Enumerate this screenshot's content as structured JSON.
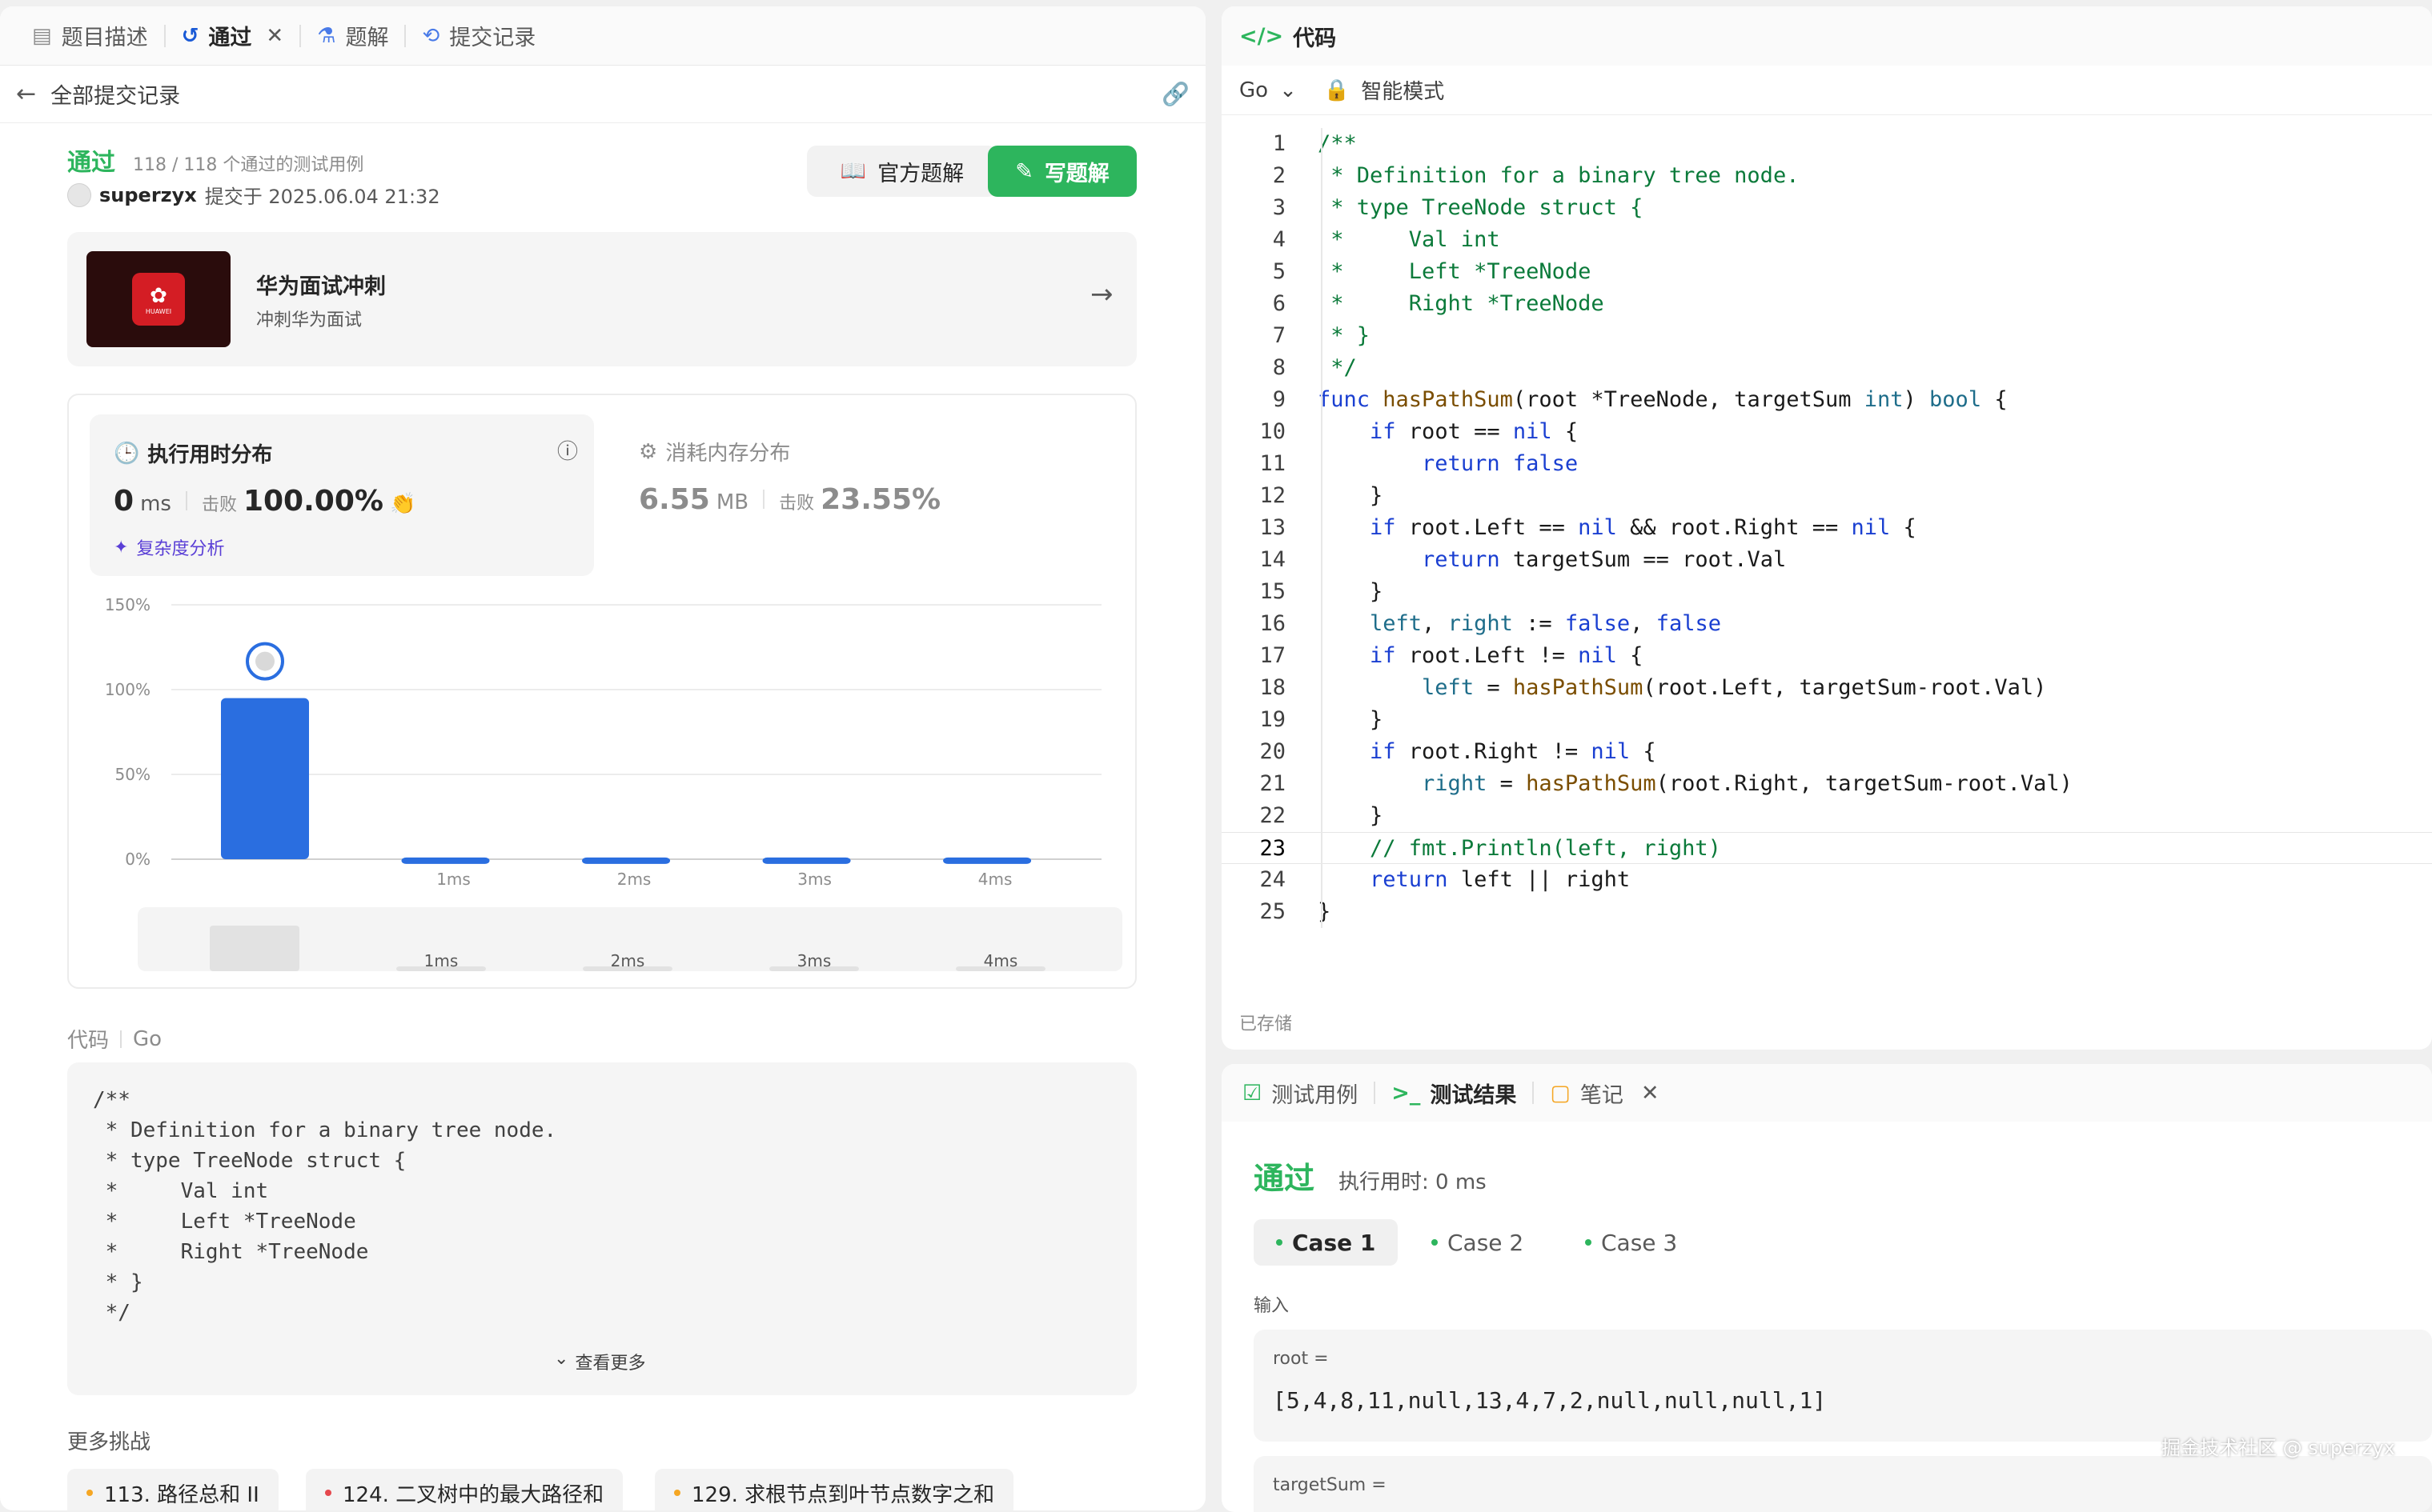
{
  "left_tabs": [
    {
      "label": "题目描述",
      "icon": "doc-icon"
    },
    {
      "label": "通过",
      "icon": "history-icon"
    },
    {
      "label": "题解",
      "icon": "flask-icon"
    },
    {
      "label": "提交记录",
      "icon": "clock-history-icon"
    }
  ],
  "back_label": "全部提交记录",
  "result": {
    "status": "通过",
    "cases": "118 / 118 个通过的测试用例",
    "user": "superzyx",
    "submitted": "提交于 2025.06.04 21:32"
  },
  "buttons": {
    "official": "官方题解",
    "write": "写题解"
  },
  "promo": {
    "title": "华为面试冲刺",
    "subtitle": "冲刺华为面试",
    "logo_text": "HUAWEI"
  },
  "runtime": {
    "title": "执行用时分布",
    "value": "0",
    "unit": "ms",
    "beat_label": "击败",
    "beat": "100.00%",
    "analysis": "复杂度分析"
  },
  "memory": {
    "title": "消耗内存分布",
    "value": "6.55",
    "unit": "MB",
    "beat_label": "击败",
    "beat": "23.55%"
  },
  "chart_data": {
    "type": "bar",
    "categories": [
      "",
      "1ms",
      "2ms",
      "3ms",
      "4ms"
    ],
    "values": [
      95,
      1,
      1,
      1,
      1
    ],
    "yticks": [
      "150%",
      "100%",
      "50%",
      "0%"
    ],
    "ylim": [
      0,
      150
    ],
    "highlight_index": 0,
    "bar_color": "#2a6ee0"
  },
  "code_section": {
    "label": "代码",
    "lang": "Go",
    "more": "查看更多"
  },
  "snippet": [
    "/**",
    " * Definition for a binary tree node.",
    " * type TreeNode struct {",
    " *     Val int",
    " *     Left *TreeNode",
    " *     Right *TreeNode",
    " * }",
    " */"
  ],
  "more_challenges": {
    "title": "更多挑战",
    "items": [
      "113. 路径总和 II",
      "124. 二叉树中的最大路径和",
      "129. 求根节点到叶节点数字之和"
    ]
  },
  "editor": {
    "title": "代码",
    "lang": "Go",
    "mode": "智能模式",
    "saved": "已存储",
    "active_line": 23
  },
  "code": [
    [
      [
        "cm",
        "/**"
      ]
    ],
    [
      [
        "cm",
        " * Definition for a binary tree node."
      ]
    ],
    [
      [
        "cm",
        " * type TreeNode struct {"
      ]
    ],
    [
      [
        "cm",
        " *     Val int"
      ]
    ],
    [
      [
        "cm",
        " *     Left *TreeNode"
      ]
    ],
    [
      [
        "cm",
        " *     Right *TreeNode"
      ]
    ],
    [
      [
        "cm",
        " * }"
      ]
    ],
    [
      [
        "cm",
        " */"
      ]
    ],
    [
      [
        "kw",
        "func "
      ],
      [
        "fn",
        "hasPathSum"
      ],
      [
        "ct",
        "(root *TreeNode, targetSum "
      ],
      [
        "ty",
        "int"
      ],
      [
        "ct",
        ") "
      ],
      [
        "ty",
        "bool"
      ],
      [
        "ct",
        " {"
      ]
    ],
    [
      [
        "ct",
        "    "
      ],
      [
        "kw",
        "if"
      ],
      [
        "ct",
        " root == "
      ],
      [
        "kw",
        "nil"
      ],
      [
        "ct",
        " {"
      ]
    ],
    [
      [
        "ct",
        "        "
      ],
      [
        "kw",
        "return false"
      ]
    ],
    [
      [
        "ct",
        "    }"
      ]
    ],
    [
      [
        "ct",
        "    "
      ],
      [
        "kw",
        "if"
      ],
      [
        "ct",
        " root.Left == "
      ],
      [
        "kw",
        "nil"
      ],
      [
        "ct",
        " && root.Right == "
      ],
      [
        "kw",
        "nil"
      ],
      [
        "ct",
        " {"
      ]
    ],
    [
      [
        "ct",
        "        "
      ],
      [
        "kw",
        "return"
      ],
      [
        "ct",
        " targetSum == root.Val"
      ]
    ],
    [
      [
        "ct",
        "    }"
      ]
    ],
    [
      [
        "ct",
        "    "
      ],
      [
        "ty",
        "left"
      ],
      [
        "ct",
        ", "
      ],
      [
        "ty",
        "right"
      ],
      [
        "ct",
        " := "
      ],
      [
        "kw",
        "false"
      ],
      [
        "ct",
        ", "
      ],
      [
        "kw",
        "false"
      ]
    ],
    [
      [
        "ct",
        "    "
      ],
      [
        "kw",
        "if"
      ],
      [
        "ct",
        " root.Left != "
      ],
      [
        "kw",
        "nil"
      ],
      [
        "ct",
        " {"
      ]
    ],
    [
      [
        "ct",
        "        "
      ],
      [
        "ty",
        "left"
      ],
      [
        "ct",
        " = "
      ],
      [
        "fn",
        "hasPathSum"
      ],
      [
        "ct",
        "(root.Left, targetSum-root.Val)"
      ]
    ],
    [
      [
        "ct",
        "    }"
      ]
    ],
    [
      [
        "ct",
        "    "
      ],
      [
        "kw",
        "if"
      ],
      [
        "ct",
        " root.Right != "
      ],
      [
        "kw",
        "nil"
      ],
      [
        "ct",
        " {"
      ]
    ],
    [
      [
        "ct",
        "        "
      ],
      [
        "ty",
        "right"
      ],
      [
        "ct",
        " = "
      ],
      [
        "fn",
        "hasPathSum"
      ],
      [
        "ct",
        "(root.Right, targetSum-root.Val)"
      ]
    ],
    [
      [
        "ct",
        "    }"
      ]
    ],
    [
      [
        "ct",
        "    "
      ],
      [
        "cm",
        "// fmt.Println(left, right)"
      ]
    ],
    [
      [
        "ct",
        "    "
      ],
      [
        "kw",
        "return"
      ],
      [
        "ct",
        " left || right"
      ]
    ],
    [
      [
        "ct",
        "}"
      ]
    ]
  ],
  "bottom_tabs": [
    {
      "label": "测试用例",
      "icon": "check-square-icon"
    },
    {
      "label": "测试结果",
      "icon": "terminal-icon"
    },
    {
      "label": "笔记",
      "icon": "note-icon"
    }
  ],
  "test": {
    "status": "通过",
    "runtime": "执行用时: 0 ms",
    "cases": [
      "Case 1",
      "Case 2",
      "Case 3"
    ],
    "input_label": "输入",
    "root_label": "root =",
    "root_value": "[5,4,8,11,null,13,4,7,2,null,null,null,1]",
    "target_label": "targetSum ="
  },
  "watermark": "掘金技术社区 @ superzyx"
}
